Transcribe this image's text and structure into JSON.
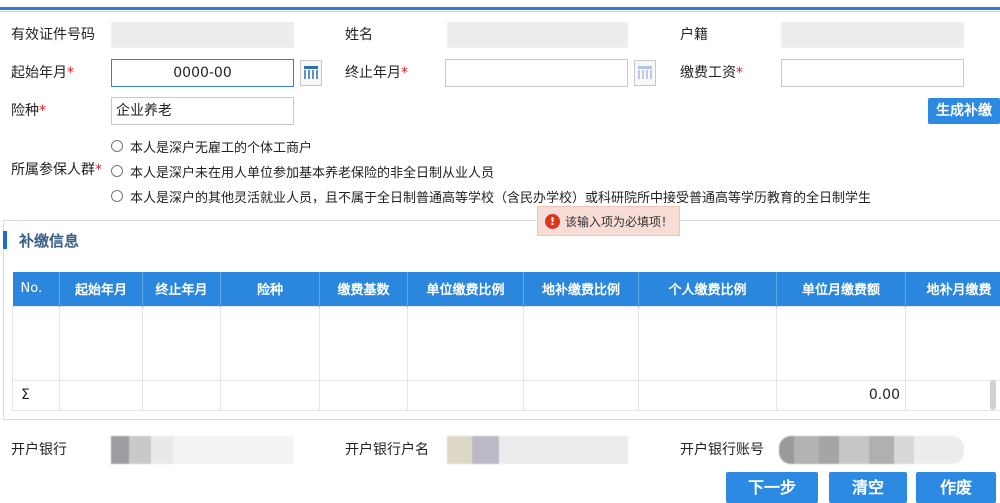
{
  "form": {
    "id_number_label": "有效证件号码",
    "name_label": "姓名",
    "household_label": "户籍",
    "start_month_label": "起始年月",
    "start_month_value": "0000-00",
    "end_month_label": "终止年月",
    "end_month_value": "",
    "wage_label": "缴费工资",
    "wage_value": "",
    "insurance_label": "险种",
    "insurance_value": "企业养老",
    "required_mark": "*",
    "generate_button": "生成补缴",
    "group_label": "所属参保人群",
    "group_options": [
      "本人是深户无雇工的个体工商户",
      "本人是深户未在用人单位参加基本养老保险的非全日制从业人员",
      "本人是深户的其他灵活就业人员，且不属于全日制普通高等学校（含民办学校）或科研院所中接受普通高等学历教育的全日制学生"
    ]
  },
  "validation_tip": "该输入项为必填项！",
  "section": {
    "title": "补缴信息"
  },
  "table": {
    "columns": [
      "No.",
      "起始年月",
      "终止年月",
      "险种",
      "缴费基数",
      "单位缴费比例",
      "地补缴费比例",
      "个人缴费比例",
      "单位月缴费额",
      "地补月缴费"
    ],
    "sum_label": "Σ",
    "sum_value": "0.00"
  },
  "bank": {
    "bank_label": "开户银行",
    "account_name_label": "开户银行户名",
    "account_number_label": "开户银行账号"
  },
  "buttons": {
    "next": "下一步",
    "clear": "清空",
    "void": "作废"
  },
  "colors": {
    "accent": "#2d8ae2",
    "required": "#dd2222",
    "header_blue": "#2a87dd"
  }
}
